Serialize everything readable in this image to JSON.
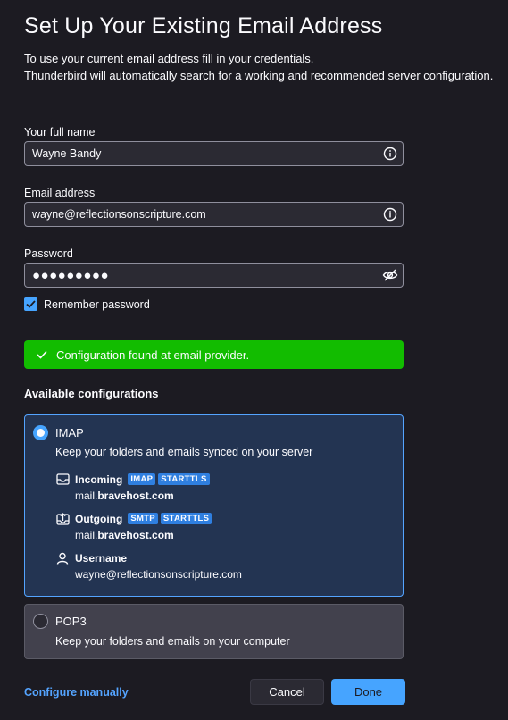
{
  "header": {
    "title": "Set Up Your Existing Email Address",
    "intro_line1": "To use your current email address fill in your credentials.",
    "intro_line2": "Thunderbird will automatically search for a working and recommended server configuration."
  },
  "form": {
    "name_label": "Your full name",
    "name_value": "Wayne Bandy",
    "email_label": "Email address",
    "email_value": "wayne@reflectionsonscripture.com",
    "password_label": "Password",
    "password_value": "●●●●●●●●●",
    "remember_label": "Remember password",
    "remember_checked": true
  },
  "status": {
    "message": "Configuration found at email provider.",
    "color": "#12bc00"
  },
  "configs": {
    "heading": "Available configurations",
    "imap": {
      "title": "IMAP",
      "description": "Keep your folders and emails synced on your server",
      "incoming_label": "Incoming",
      "incoming_tags": [
        "IMAP",
        "STARTTLS"
      ],
      "incoming_host_prefix": "mail.",
      "incoming_host_domain": "bravehost.com",
      "outgoing_label": "Outgoing",
      "outgoing_tags": [
        "SMTP",
        "STARTTLS"
      ],
      "outgoing_host_prefix": "mail.",
      "outgoing_host_domain": "bravehost.com",
      "username_label": "Username",
      "username_value": "wayne@reflectionsonscripture.com",
      "selected": true
    },
    "pop3": {
      "title": "POP3",
      "description": "Keep your folders and emails on your computer",
      "selected": false
    }
  },
  "footer": {
    "configure_manually": "Configure manually",
    "cancel": "Cancel",
    "done": "Done"
  },
  "colors": {
    "accent": "#46a4ff",
    "background": "#1c1b22",
    "success": "#12bc00"
  }
}
